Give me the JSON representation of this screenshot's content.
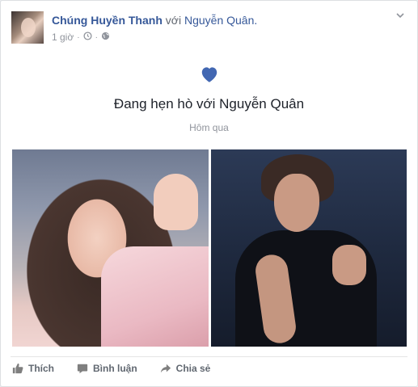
{
  "post": {
    "author": "Chúng Huyền Thanh",
    "with_text": "với",
    "tagged": "Nguyễn Quân.",
    "time": "1 giờ",
    "dot": "·"
  },
  "event": {
    "title": "Đang hẹn hò với Nguyễn Quân",
    "date": "Hôm qua"
  },
  "actions": {
    "like": "Thích",
    "comment": "Bình luận",
    "share": "Chia sẻ"
  },
  "colors": {
    "link": "#365899",
    "heart": "#4267b2",
    "meta": "#90949c",
    "action": "#606770"
  },
  "icons": [
    "chevron-down-icon",
    "clock-icon",
    "globe-icon",
    "heart-icon",
    "like-icon",
    "comment-icon",
    "share-icon"
  ]
}
